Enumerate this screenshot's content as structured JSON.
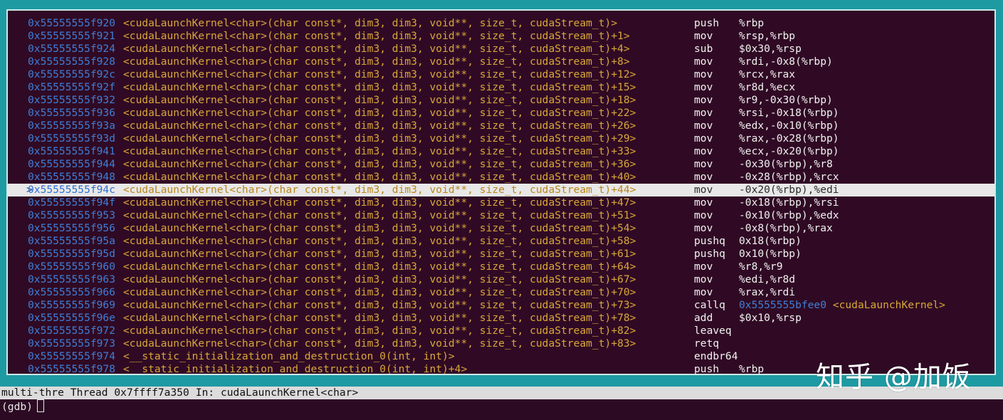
{
  "colors": {
    "background": "#300a24",
    "frame": "#1e9aa3",
    "address": "#3f7fd6",
    "symbol": "#d9a73a",
    "instruction": "#f2f2f2",
    "highlight_row": "#e8e8e8",
    "status_bar": "#dcdcdc"
  },
  "disassembly": {
    "current_marker": ">",
    "rows": [
      {
        "addr": "0x55555555f920",
        "sym": "<cudaLaunchKernel<char>(char const*, dim3, dim3, void**, size_t, cudaStream_t)>",
        "op": "push",
        "args": "%rbp"
      },
      {
        "addr": "0x55555555f921",
        "sym": "<cudaLaunchKernel<char>(char const*, dim3, dim3, void**, size_t, cudaStream_t)+1>",
        "op": "mov",
        "args": "%rsp,%rbp"
      },
      {
        "addr": "0x55555555f924",
        "sym": "<cudaLaunchKernel<char>(char const*, dim3, dim3, void**, size_t, cudaStream_t)+4>",
        "op": "sub",
        "args": "$0x30,%rsp"
      },
      {
        "addr": "0x55555555f928",
        "sym": "<cudaLaunchKernel<char>(char const*, dim3, dim3, void**, size_t, cudaStream_t)+8>",
        "op": "mov",
        "args": "%rdi,-0x8(%rbp)"
      },
      {
        "addr": "0x55555555f92c",
        "sym": "<cudaLaunchKernel<char>(char const*, dim3, dim3, void**, size_t, cudaStream_t)+12>",
        "op": "mov",
        "args": "%rcx,%rax"
      },
      {
        "addr": "0x55555555f92f",
        "sym": "<cudaLaunchKernel<char>(char const*, dim3, dim3, void**, size_t, cudaStream_t)+15>",
        "op": "mov",
        "args": "%r8d,%ecx"
      },
      {
        "addr": "0x55555555f932",
        "sym": "<cudaLaunchKernel<char>(char const*, dim3, dim3, void**, size_t, cudaStream_t)+18>",
        "op": "mov",
        "args": "%r9,-0x30(%rbp)"
      },
      {
        "addr": "0x55555555f936",
        "sym": "<cudaLaunchKernel<char>(char const*, dim3, dim3, void**, size_t, cudaStream_t)+22>",
        "op": "mov",
        "args": "%rsi,-0x18(%rbp)"
      },
      {
        "addr": "0x55555555f93a",
        "sym": "<cudaLaunchKernel<char>(char const*, dim3, dim3, void**, size_t, cudaStream_t)+26>",
        "op": "mov",
        "args": "%edx,-0x10(%rbp)"
      },
      {
        "addr": "0x55555555f93d",
        "sym": "<cudaLaunchKernel<char>(char const*, dim3, dim3, void**, size_t, cudaStream_t)+29>",
        "op": "mov",
        "args": "%rax,-0x28(%rbp)"
      },
      {
        "addr": "0x55555555f941",
        "sym": "<cudaLaunchKernel<char>(char const*, dim3, dim3, void**, size_t, cudaStream_t)+33>",
        "op": "mov",
        "args": "%ecx,-0x20(%rbp)"
      },
      {
        "addr": "0x55555555f944",
        "sym": "<cudaLaunchKernel<char>(char const*, dim3, dim3, void**, size_t, cudaStream_t)+36>",
        "op": "mov",
        "args": "-0x30(%rbp),%r8"
      },
      {
        "addr": "0x55555555f948",
        "sym": "<cudaLaunchKernel<char>(char const*, dim3, dim3, void**, size_t, cudaStream_t)+40>",
        "op": "mov",
        "args": "-0x28(%rbp),%rcx"
      },
      {
        "addr": "0x55555555f94c",
        "sym": "<cudaLaunchKernel<char>(char const*, dim3, dim3, void**, size_t, cudaStream_t)+44>",
        "op": "mov",
        "args": "-0x20(%rbp),%edi",
        "current": true
      },
      {
        "addr": "0x55555555f94f",
        "sym": "<cudaLaunchKernel<char>(char const*, dim3, dim3, void**, size_t, cudaStream_t)+47>",
        "op": "mov",
        "args": "-0x18(%rbp),%rsi"
      },
      {
        "addr": "0x55555555f953",
        "sym": "<cudaLaunchKernel<char>(char const*, dim3, dim3, void**, size_t, cudaStream_t)+51>",
        "op": "mov",
        "args": "-0x10(%rbp),%edx"
      },
      {
        "addr": "0x55555555f956",
        "sym": "<cudaLaunchKernel<char>(char const*, dim3, dim3, void**, size_t, cudaStream_t)+54>",
        "op": "mov",
        "args": "-0x8(%rbp),%rax"
      },
      {
        "addr": "0x55555555f95a",
        "sym": "<cudaLaunchKernel<char>(char const*, dim3, dim3, void**, size_t, cudaStream_t)+58>",
        "op": "pushq",
        "args": "0x18(%rbp)"
      },
      {
        "addr": "0x55555555f95d",
        "sym": "<cudaLaunchKernel<char>(char const*, dim3, dim3, void**, size_t, cudaStream_t)+61>",
        "op": "pushq",
        "args": "0x10(%rbp)"
      },
      {
        "addr": "0x55555555f960",
        "sym": "<cudaLaunchKernel<char>(char const*, dim3, dim3, void**, size_t, cudaStream_t)+64>",
        "op": "mov",
        "args": "%r8,%r9"
      },
      {
        "addr": "0x55555555f963",
        "sym": "<cudaLaunchKernel<char>(char const*, dim3, dim3, void**, size_t, cudaStream_t)+67>",
        "op": "mov",
        "args": "%edi,%r8d"
      },
      {
        "addr": "0x55555555f966",
        "sym": "<cudaLaunchKernel<char>(char const*, dim3, dim3, void**, size_t, cudaStream_t)+70>",
        "op": "mov",
        "args": "%rax,%rdi"
      },
      {
        "addr": "0x55555555f969",
        "sym": "<cudaLaunchKernel<char>(char const*, dim3, dim3, void**, size_t, cudaStream_t)+73>",
        "op": "callq",
        "args": "",
        "target_addr": "0x5555555bfee0",
        "target_sym": "<cudaLaunchKernel>"
      },
      {
        "addr": "0x55555555f96e",
        "sym": "<cudaLaunchKernel<char>(char const*, dim3, dim3, void**, size_t, cudaStream_t)+78>",
        "op": "add",
        "args": "$0x10,%rsp"
      },
      {
        "addr": "0x55555555f972",
        "sym": "<cudaLaunchKernel<char>(char const*, dim3, dim3, void**, size_t, cudaStream_t)+82>",
        "op": "leaveq",
        "args": ""
      },
      {
        "addr": "0x55555555f973",
        "sym": "<cudaLaunchKernel<char>(char const*, dim3, dim3, void**, size_t, cudaStream_t)+83>",
        "op": "retq",
        "args": ""
      },
      {
        "addr": "0x55555555f974",
        "sym": "<__static_initialization_and_destruction_0(int, int)>",
        "op": "endbr64",
        "args": ""
      },
      {
        "addr": "0x55555555f978",
        "sym": "<__static_initialization_and_destruction_0(int, int)+4>",
        "op": "push",
        "args": "%rbp"
      }
    ]
  },
  "status_bar": {
    "target": "multi-thre",
    "thread": "Thread 0x7ffff7a350",
    "location": "In: cudaLaunchKernel<char>"
  },
  "console": {
    "prompt": "(gdb)"
  },
  "watermark": {
    "text": "知乎 @加饭"
  }
}
